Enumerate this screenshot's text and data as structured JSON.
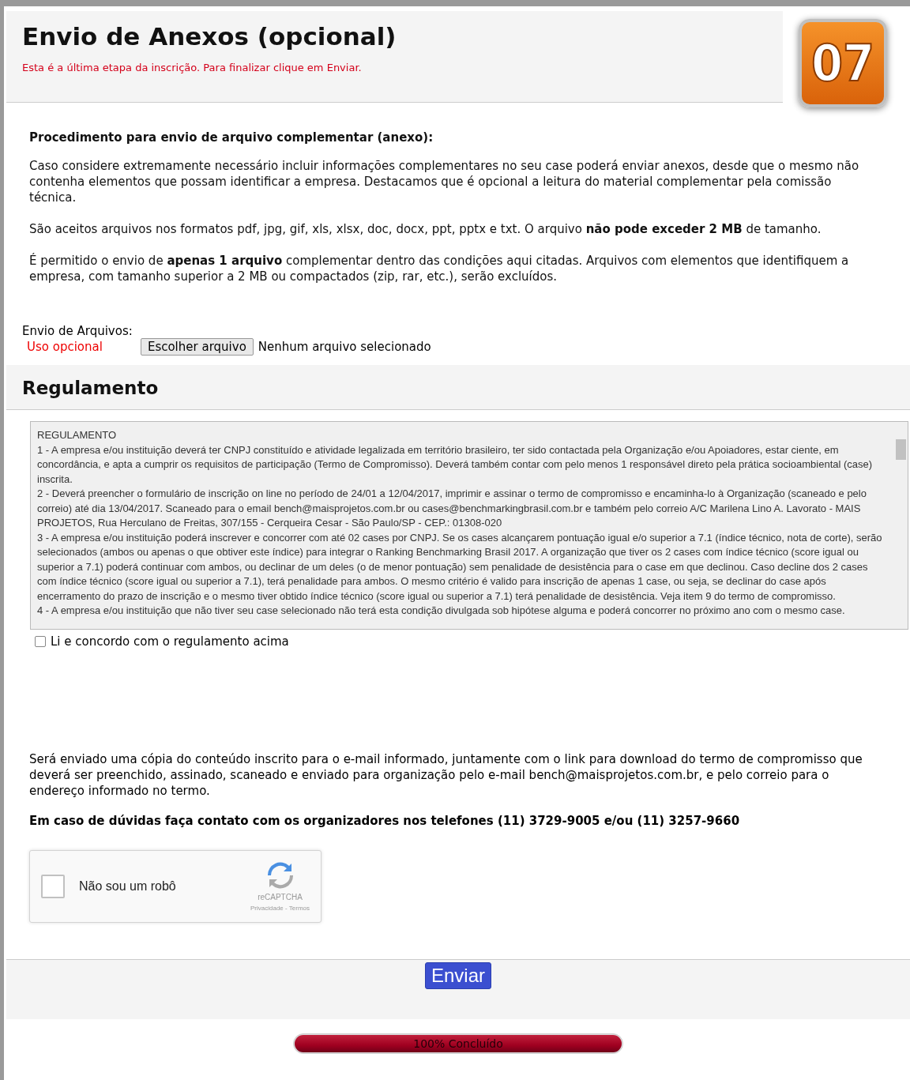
{
  "header": {
    "title": "Envio de Anexos (opcional)",
    "subtitle": "Esta é a última etapa da inscrição. Para finalizar clique em Enviar.",
    "step_badge": "07"
  },
  "procedure": {
    "heading": "Procedimento para envio de arquivo complementar (anexo):",
    "paragraphs": [
      "Caso considere extremamente necessário incluir informações complementares no seu case poderá enviar anexos, desde que o mesmo não contenha elementos que possam identificar a empresa. Destacamos que é opcional a leitura do material complementar pela comissão técnica.",
      "São aceitos arquivos nos formatos pdf, jpg, gif, xls, xlsx, doc, docx, ppt, pptx e txt. O arquivo **não pode exceder 2 MB** de tamanho.",
      "É permitido o envio de **apenas 1 arquivo** complementar dentro das condições aqui citadas. Arquivos com elementos que identifiquem a empresa, com tamanho superior a 2 MB ou compactados (zip, rar, etc.), serão excluídos."
    ]
  },
  "upload": {
    "label": "Envio de Arquivos:",
    "hint": "Uso opcional",
    "button": "Escolher arquivo",
    "status": "Nenhum arquivo selecionado"
  },
  "regulation": {
    "heading": "Regulamento",
    "lines": [
      "REGULAMENTO",
      "1 - A empresa e/ou instituição deverá ter CNPJ constituído e atividade legalizada em território brasileiro, ter sido contactada pela Organização e/ou Apoiadores, estar ciente, em concordância, e apta a cumprir os requisitos de participação (Termo de Compromisso). Deverá também contar com pelo menos 1 responsável direto pela prática socioambiental (case) inscrita.",
      "2 - Deverá preencher o formulário de inscrição on line no período de 24/01 a 12/04/2017, imprimir e assinar o termo de compromisso e encaminha-lo à Organização (scaneado e pelo correio) até dia 13/04/2017. Scaneado para o email bench@maisprojetos.com.br ou cases@benchmarkingbrasil.com.br  e também pelo correio A/C Marilena Lino A. Lavorato - MAIS PROJETOS, Rua Herculano de Freitas, 307/155 - Cerqueira Cesar - São Paulo/SP - CEP.: 01308-020",
      "3 - A empresa e/ou instituição poderá inscrever e concorrer com até 02 cases por CNPJ. Se os cases alcançarem pontuação igual e/o superior a 7.1 (índice técnico, nota de corte), serão selecionados (ambos ou apenas o que obtiver este índice) para integrar o Ranking Benchmarking Brasil 2017. A organização que tiver os 2 cases com índice técnico (score igual ou superior a 7.1) poderá continuar com ambos, ou declinar de um deles (o de menor pontuação) sem penalidade de desistência para o case em que declinou. Caso decline dos 2 cases com índice técnico (score igual ou superior a 7.1), terá penalidade para ambos. O mesmo critério é valido para inscrição de apenas 1 case, ou seja, se declinar do case após encerramento do prazo de inscrição e o mesmo tiver obtido índice técnico (score igual ou superior a 7.1) terá penalidade de desistência. Veja item 9 do termo de compromisso.",
      "4 - A empresa e/ou instituição que não tiver seu case selecionado não terá esta condição divulgada sob hipótese alguma e poderá concorrer no próximo ano com o mesmo case."
    ],
    "agree": {
      "label": "Li e concordo com o regulamento acima",
      "checked": false
    }
  },
  "notice": "Será enviado uma cópia do conteúdo inscrito para o e-mail informado, juntamente com o link para download do termo de compromisso que deverá ser preenchido, assinado, scaneado e enviado para organização pelo e-mail bench@maisprojetos.com.br, e pelo correio para o endereço informado no termo.",
  "contact": "Em caso de dúvidas faça contato com os organizadores nos telefones (11) 3729-9005 e/ou (11) 3257-9660",
  "captcha": {
    "label": "Não sou um robô",
    "checked": false,
    "brand": "reCAPTCHA",
    "links": "Privacidade - Termos"
  },
  "submit": "Enviar",
  "progress": {
    "label": "100% Concluído",
    "level": 1
  }
}
